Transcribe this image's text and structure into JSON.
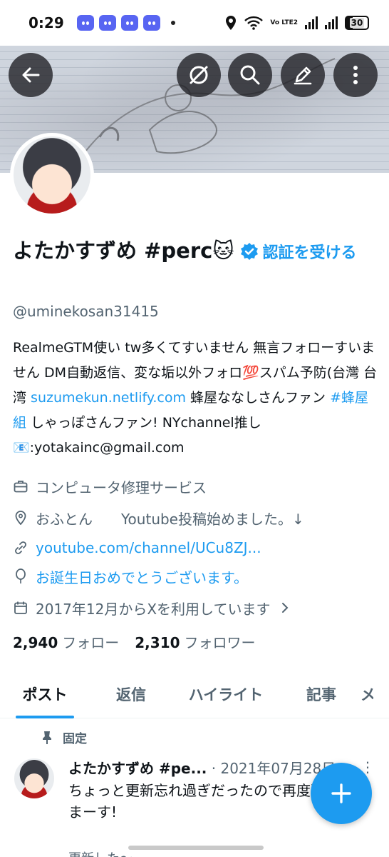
{
  "status_bar": {
    "time": "0:29",
    "battery": "30",
    "volte": "Vo LTE2"
  },
  "banner": {
    "buttons": [
      "back-icon",
      "mute-icon",
      "search-icon",
      "edit-icon",
      "more-vertical-icon"
    ]
  },
  "profile": {
    "name": "よたかすずめ #perc🐱",
    "verify_link": "認証を受ける",
    "handle": "@uminekosan31415",
    "bio_text_1": "RealmeGTM使い tw多くてすいません 無言フォローすいません DM自動返信、変な垢以外フォロ💯スパム予防(台灣 台湾 ",
    "bio_link": "suzumekun.netlify.com",
    "bio_text_2": " 蜂屋ななしさんファン ",
    "bio_hashtag": "#蜂屋組",
    "bio_text_3": " しゃっぽさんファン! NYchannel推し 📧:yotakainc@gmail.com",
    "category": "コンピュータ修理サービス",
    "location": "おふとん　　Youtube投稿始めました。↓",
    "website": "youtube.com/channel/UCu8ZJ...",
    "birthday": "お誕生日おめでとうございます。",
    "joined": "2017年12月からXを利用しています",
    "following_count": "2,940",
    "following_label": "フォロー",
    "followers_count": "2,310",
    "followers_label": "フォロワー"
  },
  "tabs": [
    {
      "label": "ポスト",
      "active": true
    },
    {
      "label": "返信",
      "active": false
    },
    {
      "label": "ハイライト",
      "active": false
    },
    {
      "label": "記事",
      "active": false
    },
    {
      "label": "メ",
      "active": false
    }
  ],
  "pinned_post": {
    "pinned_label": "固定",
    "author": "よたかすずめ #pe...",
    "date": "· 2021年07月28日",
    "text": "ちょっと更新忘れ過ぎだったので再度更新しまーす!",
    "more": "⋮"
  },
  "next_post_preview": "更新した～"
}
